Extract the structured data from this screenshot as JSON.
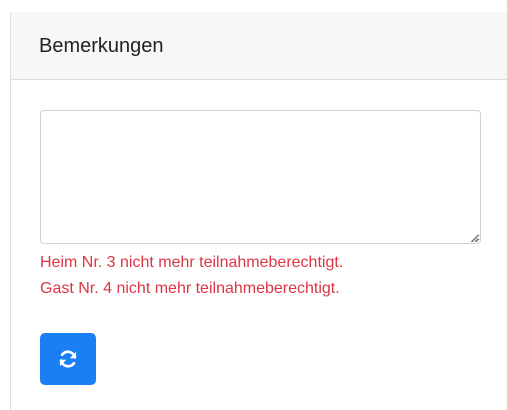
{
  "card": {
    "title": "Bemerkungen"
  },
  "remarks": {
    "value": "",
    "placeholder": ""
  },
  "errors": [
    "Heim Nr. 3 nicht mehr teilnahmeberechtigt.",
    "Gast Nr. 4 nicht mehr teilnahmeberechtigt."
  ],
  "refresh_button": {
    "icon": "refresh-icon",
    "color": "#1a7ff5"
  },
  "colors": {
    "error": "#dc3545",
    "header_bg": "#f7f7f7"
  }
}
